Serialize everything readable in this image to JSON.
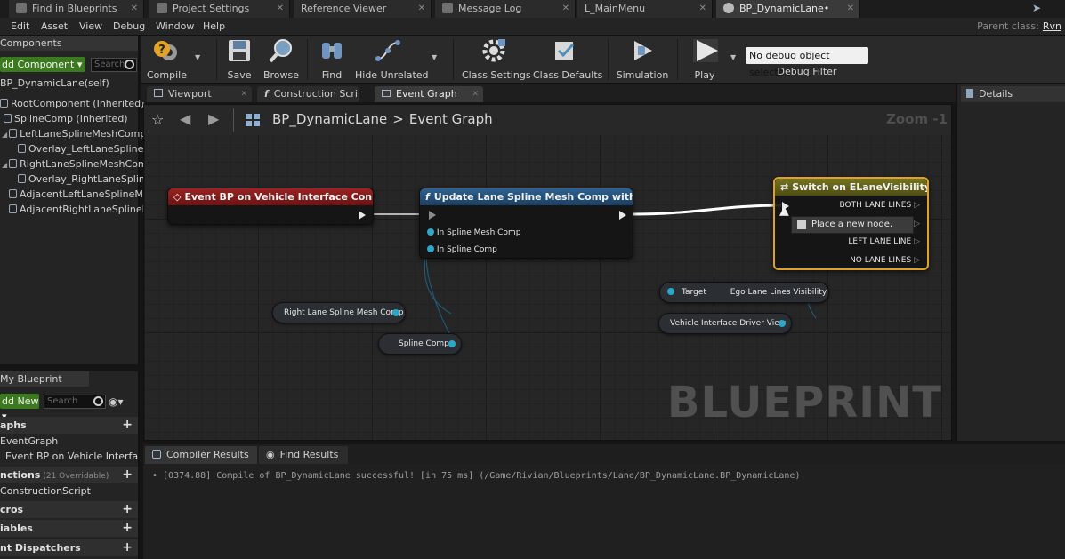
{
  "tabs": [
    {
      "label": "Find in Blueprints"
    },
    {
      "label": "Project Settings"
    },
    {
      "label": "Reference Viewer"
    },
    {
      "label": "Message Log"
    },
    {
      "label": "L_MainMenu"
    },
    {
      "label": "BP_DynamicLane•"
    }
  ],
  "menu": {
    "items": [
      "Edit",
      "Asset",
      "View",
      "Debug",
      "Window",
      "Help"
    ],
    "parent_class_label": "Parent class:",
    "parent_class_value": "Rvn"
  },
  "components_panel": {
    "title": "Components",
    "add_button": "dd Component ▾",
    "search_placeholder": "Search",
    "self_label": "BP_DynamicLane(self)",
    "tree": [
      "RootComponent (Inherited)",
      "SplineComp (Inherited)",
      "LeftLaneSplineMeshComp (I",
      "Overlay_LeftLaneSplineMe",
      "RightLaneSplineMeshComp",
      "Overlay_RightLaneSplineM",
      "AdjacentLeftLaneSplineMes",
      "AdjacentRightLaneSplineMe"
    ]
  },
  "my_blueprint": {
    "title": "My Blueprint",
    "add_button": "dd New ▾",
    "search_placeholder": "Search",
    "graphs_label": "aphs",
    "event_graph": "EventGraph",
    "event_item": "Event BP on Vehicle Interfa",
    "functions_label": "nctions",
    "functions_overridable": "(21 Overridable)",
    "construction_script": "ConstructionScript",
    "macros_label": "cros",
    "variables_label": "iables",
    "dispatchers_label": "nt Dispatchers"
  },
  "toolbar": {
    "compile": "Compile",
    "save": "Save",
    "browse": "Browse",
    "find": "Find",
    "hide_unrelated": "Hide Unrelated",
    "class_settings": "Class Settings",
    "class_defaults": "Class Defaults",
    "simulation": "Simulation",
    "play": "Play",
    "debug_select": "No debug object selected ▾",
    "debug_filter": "Debug Filter"
  },
  "editor_tabs": [
    {
      "label": "Viewport"
    },
    {
      "label": "Construction Scrip"
    },
    {
      "label": "Event Graph"
    }
  ],
  "graph": {
    "breadcrumb_root": "BP_DynamicLane",
    "breadcrumb_sep": ">",
    "breadcrumb_leaf": "Event Graph",
    "zoom": "Zoom -1",
    "watermark": "BLUEPRINT",
    "event_node_title": "Event BP on Vehicle Interface Connected",
    "update_node_title": "Update Lane Spline Mesh Comp with Spline",
    "update_pin_1": "In Spline Mesh Comp",
    "update_pin_2": "In Spline Comp",
    "switch_node_title": "Switch on ELaneVisibility",
    "switch_pins": [
      "BOTH LANE LINES",
      "E",
      "LEFT LANE LINE",
      "NO LANE LINES"
    ],
    "context_popup": "Place a new node.",
    "var_right_lane": "Right Lane Spline Mesh Comp",
    "var_spline_comp": "Spline Comp",
    "target_label": "Target",
    "ego_label": "Ego Lane Lines Visibility",
    "driver_view": "Vehicle Interface Driver View"
  },
  "details": {
    "title": "Details"
  },
  "bottom_tabs": [
    {
      "label": "Compiler Results"
    },
    {
      "label": "Find Results"
    }
  ],
  "compiler": {
    "log": "• [0374.88] Compile of BP_DynamicLane successful! [in 75 ms] (/Game/Rivian/Blueprints/Lane/BP_DynamicLane.BP_DynamicLane)"
  },
  "colors": {
    "event_header": "#8a1b1b",
    "function_header": "#1f4f7a",
    "switch_header": "#6b6a1c",
    "switch_border": "#e0a12a",
    "accent_green": "#3c7a1f"
  }
}
